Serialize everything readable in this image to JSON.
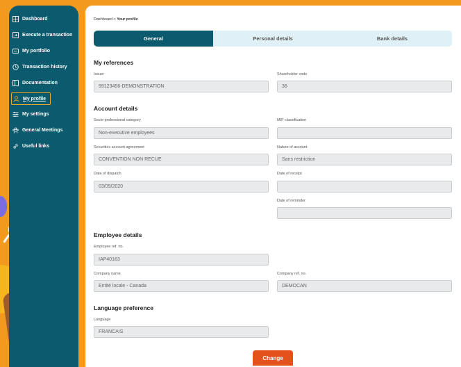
{
  "sidebar": {
    "items": [
      {
        "label": "Dashboard",
        "icon": "dashboard-icon"
      },
      {
        "label": "Execute a transaction",
        "icon": "transaction-icon"
      },
      {
        "label": "My portfolio",
        "icon": "portfolio-icon"
      },
      {
        "label": "Transaction history",
        "icon": "history-icon"
      },
      {
        "label": "Documentation",
        "icon": "documentation-icon"
      },
      {
        "label": "My profile",
        "icon": "profile-icon",
        "active": true
      },
      {
        "label": "My settings",
        "icon": "settings-icon"
      },
      {
        "label": "General Meetings",
        "icon": "meetings-icon"
      },
      {
        "label": "Useful links",
        "icon": "link-icon"
      }
    ]
  },
  "breadcrumb": {
    "root": "Dashboard",
    "separator": ">",
    "current": "Your profile"
  },
  "tabs": [
    {
      "label": "General",
      "active": true
    },
    {
      "label": "Personal details"
    },
    {
      "label": "Bank details"
    }
  ],
  "sections": {
    "references": {
      "title": "My references",
      "issuer_label": "Issuer",
      "issuer_value": "99123456-DEMONSTRATION",
      "shareholder_label": "Shareholder code",
      "shareholder_value": "38"
    },
    "account": {
      "title": "Account details",
      "socio_label": "Socio-professional category",
      "socio_value": "Non-executive employees",
      "mif_label": "MIF classification",
      "mif_value": "",
      "agreement_label": "Securities account agreement",
      "agreement_value": "CONVENTION NON RECUE",
      "nature_label": "Nature of account",
      "nature_value": "Sans restriction",
      "dispatch_label": "Date of dispatch",
      "dispatch_value": "03/09/2020",
      "receipt_label": "Date of receipt",
      "receipt_value": "",
      "reminder_label": "Date of reminder",
      "reminder_value": ""
    },
    "employee": {
      "title": "Employee details",
      "ref_label": "Employee ref. no.",
      "ref_value": "IAP40163",
      "company_label": "Company name",
      "company_value": "Entité locale - Canada",
      "company_ref_label": "Company ref. no.",
      "company_ref_value": "DEMOCAN"
    },
    "language": {
      "title": "Language preference",
      "lang_label": "Language",
      "lang_value": "FRANCAIS"
    }
  },
  "actions": {
    "change_label": "Change"
  },
  "colors": {
    "sidebar": "#0c5a6e",
    "accent": "#f39a1e",
    "button": "#e2521a",
    "active_outline": "#f5a623"
  }
}
